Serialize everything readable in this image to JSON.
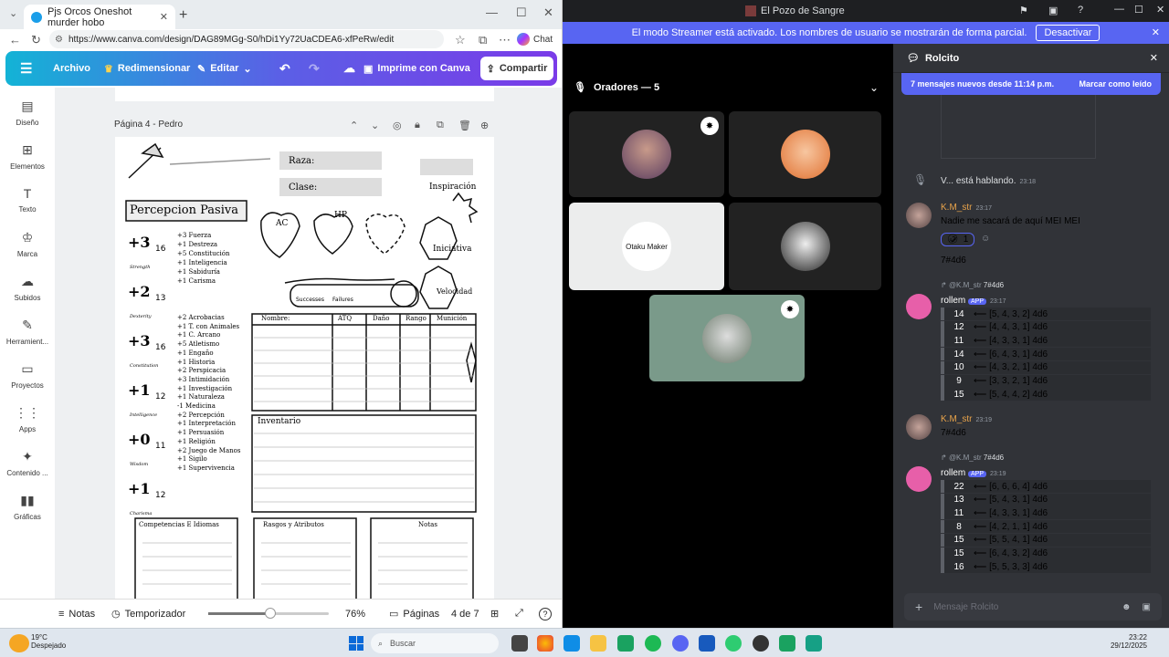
{
  "browser": {
    "tab_title": "Pjs Orcos Oneshot murder hobo",
    "url": "https://www.canva.com/design/DAG89MGg-S0/hDi1Yy72UaCDEA6-xfPeRw/edit",
    "chat_label": "Chat"
  },
  "canva": {
    "menu": {
      "archivo": "Archivo",
      "redimensionar": "Redimensionar",
      "editar": "Editar",
      "imprime": "Imprime con Canva",
      "compartir": "Compartir"
    },
    "rail": [
      {
        "label": "Diseño",
        "icon": "layout-icon"
      },
      {
        "label": "Elementos",
        "icon": "elements-icon"
      },
      {
        "label": "Texto",
        "icon": "text-icon"
      },
      {
        "label": "Marca",
        "icon": "brand-icon"
      },
      {
        "label": "Subidos",
        "icon": "upload-icon"
      },
      {
        "label": "Herramient...",
        "icon": "tools-icon"
      },
      {
        "label": "Proyectos",
        "icon": "folder-icon"
      },
      {
        "label": "Apps",
        "icon": "apps-icon"
      },
      {
        "label": "Contenido ...",
        "icon": "content-icon"
      },
      {
        "label": "Gráficas",
        "icon": "chart-icon"
      }
    ],
    "page_label": "Página 4 - Pedro",
    "footer": {
      "notas": "Notas",
      "temporizador": "Temporizador",
      "zoom": "76%",
      "paginas": "Páginas",
      "page_count": "4 de 7"
    }
  },
  "sheet": {
    "raza": "Raza:",
    "clase": "Clase:",
    "inspiracion": "Inspiración",
    "percepcion": "Percepcion Pasiva",
    "ac": "AC",
    "hp": "HP",
    "iniciativa": "Iniciativa",
    "velocidad": "Velocidad",
    "successes": "Successes",
    "failures": "Failures",
    "abilities": [
      {
        "mod": "+3",
        "score": "16",
        "name": "Strength"
      },
      {
        "mod": "+2",
        "score": "13",
        "name": "Dexterity"
      },
      {
        "mod": "+3",
        "score": "16",
        "name": "Constitution"
      },
      {
        "mod": "+1",
        "score": "12",
        "name": "Intelligence"
      },
      {
        "mod": "+0",
        "score": "11",
        "name": "Wisdom"
      },
      {
        "mod": "+1",
        "score": "12",
        "name": "Charisma"
      }
    ],
    "saves": [
      "+3 Fuerza",
      "+1 Destreza",
      "+5 Constitución",
      "+1 Inteligencia",
      "+1 Sabiduría",
      "+1 Carisma"
    ],
    "skills": [
      "+2 Acrobacias",
      "+1 T. con Animales",
      "+1 C. Arcano",
      "+5 Atletismo",
      "+1 Engaño",
      "+1 Historia",
      "+2 Perspicacia",
      "+3 Intimidación",
      "+1 Investigación",
      "+1 Naturaleza",
      "-1 Medicina",
      "+2 Percepción",
      "+1 Interpretación",
      "+1 Persuasión",
      "+1 Religión",
      "+2 Juego de Manos",
      "+1 Sigilo",
      "+1 Supervivencia"
    ],
    "attacks_headers": [
      "Nombre:",
      "ATQ",
      "Daño",
      "Rango",
      "Munición"
    ],
    "inventario": "Inventario",
    "bottom_boxes": [
      "Competencias E Idiomas",
      "Rasgos y Atributos",
      "Notas"
    ]
  },
  "discord": {
    "window_title": "El Pozo de Sangre",
    "banner": "El modo Streamer está activado. Los nombres de usuario se mostrarán de forma parcial.",
    "banner_button": "Desactivar",
    "speakers": "Oradores — 5",
    "chat_title": "Rolcito",
    "new_messages": "7 mensajes nuevos desde 11:14 p.m.",
    "mark_read": "Marcar como leído",
    "talking": "V... está hablando.",
    "talking_time": "23:18",
    "msg1": {
      "user": "K.M_str",
      "time": "23:17",
      "text": "Nadie me sacará de aquí MEI MEI",
      "reaction_count": "1",
      "cmd": "7#4d6"
    },
    "reply1": {
      "user": "@K.M_str",
      "text": "7#4d6"
    },
    "bot": {
      "name": "rollem",
      "tag": "APP"
    },
    "bot1_time": "23:17",
    "rolls1": [
      {
        "sum": "14",
        "text": "⟵ [5, 4, 3, 2] 4d6"
      },
      {
        "sum": "12",
        "text": "⟵ [4, 4, 3, 1] 4d6"
      },
      {
        "sum": "11",
        "text": "⟵ [4, 3, 3, 1] 4d6"
      },
      {
        "sum": "14",
        "text": "⟵ [6, 4, 3, 1] 4d6"
      },
      {
        "sum": "10",
        "text": "⟵ [4, 3, 2, 1] 4d6"
      },
      {
        "sum": "9",
        "text": "⟵ [3, 3, 2, 1] 4d6"
      },
      {
        "sum": "15",
        "text": "⟵ [5, 4, 4, 2] 4d6"
      }
    ],
    "msg2": {
      "user": "K.M_str",
      "time": "23:19",
      "cmd": "7#4d6"
    },
    "bot2_time": "23:19",
    "rolls2": [
      {
        "sum": "22",
        "text": "⟵ [6, 6, 6, 4] 4d6"
      },
      {
        "sum": "13",
        "text": "⟵ [5, 4, 3, 1] 4d6"
      },
      {
        "sum": "11",
        "text": "⟵ [4, 3, 3, 1] 4d6"
      },
      {
        "sum": "8",
        "text": "⟵ [4, 2, 1, 1] 4d6"
      },
      {
        "sum": "15",
        "text": "⟵ [5, 5, 4, 1] 4d6"
      },
      {
        "sum": "15",
        "text": "⟵ [6, 4, 3, 2] 4d6"
      },
      {
        "sum": "16",
        "text": "⟵ [5, 5, 3, 3] 4d6"
      }
    ],
    "input_placeholder": "Mensaje Rolcito",
    "tile_text": "Otaku Maker"
  },
  "taskbar": {
    "temp": "19°C",
    "weather": "Despejado",
    "search": "Buscar",
    "time": "23:22",
    "date": "29/12/2025"
  }
}
